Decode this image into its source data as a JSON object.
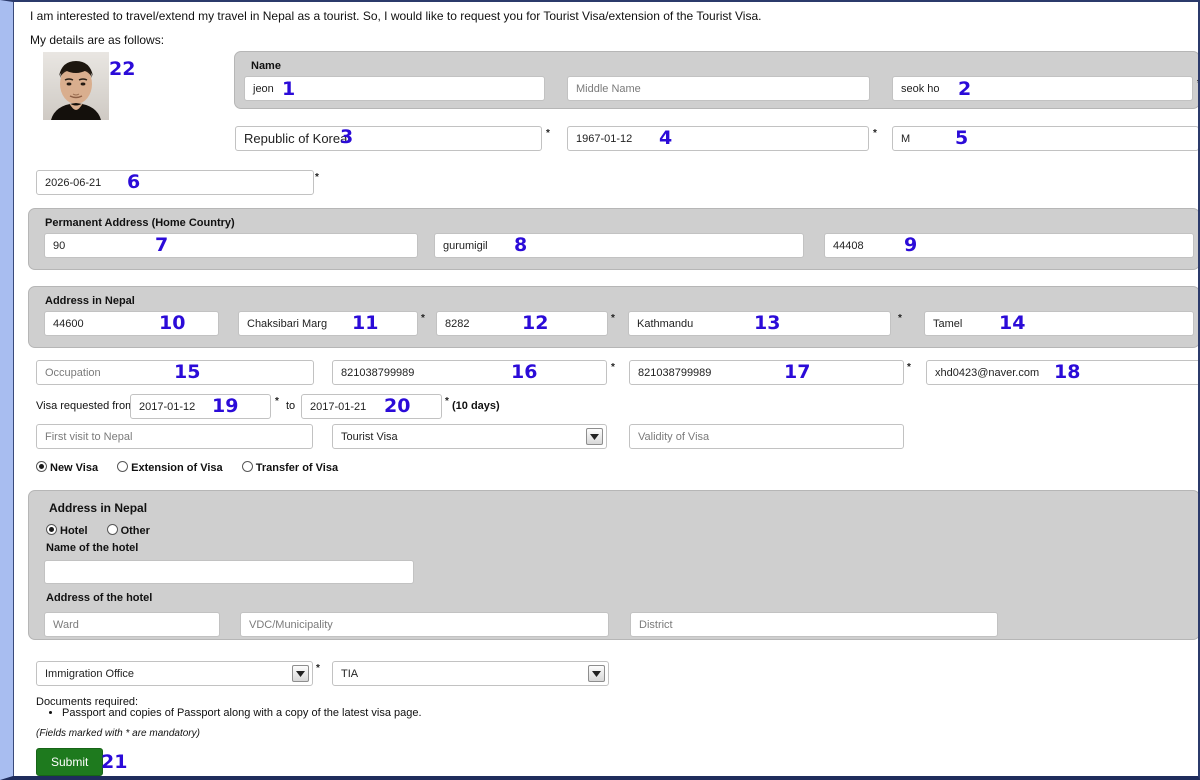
{
  "intro": {
    "line1": "I am interested to travel/extend my travel in Nepal as a tourist. So, I would like to request you for Tourist Visa/extension of the Tourist Visa.",
    "line2": "My details are as follows:"
  },
  "markers": {
    "m1": "1",
    "m2": "2",
    "m3": "3",
    "m4": "4",
    "m5": "5",
    "m6": "6",
    "m7": "7",
    "m8": "8",
    "m9": "9",
    "m10": "10",
    "m11": "11",
    "m12": "12",
    "m13": "13",
    "m14": "14",
    "m15": "15",
    "m16": "16",
    "m17": "17",
    "m18": "18",
    "m19": "19",
    "m20": "20",
    "m21": "21",
    "m22": "22"
  },
  "photo": {
    "alt": "applicant-passport-photo"
  },
  "name_panel": {
    "title": "Name",
    "first_name": "jeon",
    "middle_name_placeholder": "Middle Name",
    "last_name": "seok ho"
  },
  "identity": {
    "nationality": "Republic of Korea",
    "date_of_birth": "1967-01-12",
    "gender": "M",
    "passport_expiry": "2026-06-21"
  },
  "permanent_address": {
    "title": "Permanent Address (Home Country)",
    "house_no": "90",
    "street": "gurumigil",
    "postal_code": "44408"
  },
  "address_nepal": {
    "title": "Address in Nepal",
    "zip": "44600",
    "street": "Chaksibari Marg",
    "house_no": "8282",
    "city": "Kathmandu",
    "tole": "Tamel"
  },
  "contact": {
    "occupation_placeholder": "Occupation",
    "phone": "821038799989",
    "mobile": "821038799989",
    "email": "xhd0423@naver.com"
  },
  "visa_dates": {
    "label_from": "Visa requested from",
    "from": "2017-01-12",
    "label_to": "to",
    "to": "2017-01-21",
    "days_note": "(10 days)"
  },
  "visa_row": {
    "first_visit_placeholder": "First visit to Nepal",
    "visa_type_selected": "Tourist Visa",
    "visa_type_options": [
      "Tourist Visa"
    ],
    "validity_placeholder": "Validity of Visa"
  },
  "visa_kind": {
    "options": [
      {
        "label": "New Visa",
        "selected": true
      },
      {
        "label": "Extension of Visa",
        "selected": false
      },
      {
        "label": "Transfer of Visa",
        "selected": false
      }
    ]
  },
  "stay_panel": {
    "title": "Address in Nepal",
    "stay_options": [
      {
        "label": "Hotel",
        "selected": true
      },
      {
        "label": "Other",
        "selected": false
      }
    ],
    "hotel_name_label": "Name of the hotel",
    "hotel_name_value": "",
    "hotel_address_label": "Address of the hotel",
    "ward_placeholder": "Ward",
    "vdc_placeholder": "VDC/Municipality",
    "district_placeholder": "District"
  },
  "office_row": {
    "office_selected": "Immigration Office",
    "office_options": [
      "Immigration Office"
    ],
    "entry_point_selected": "TIA",
    "entry_point_options": [
      "TIA"
    ]
  },
  "footer": {
    "docs_title": "Documents required:",
    "docs_items": [
      "Passport and copies of Passport along with a copy of the latest visa page."
    ],
    "mandatory_note": "(Fields marked with * are mandatory)",
    "submit_label": "Submit"
  },
  "symbols": {
    "required_star": "*"
  },
  "colors": {
    "marker": "#2b0bd8",
    "panel_bg": "#cfcfcf",
    "submit_bg": "#1e7a1e",
    "page_border": "#a8bdf0"
  }
}
